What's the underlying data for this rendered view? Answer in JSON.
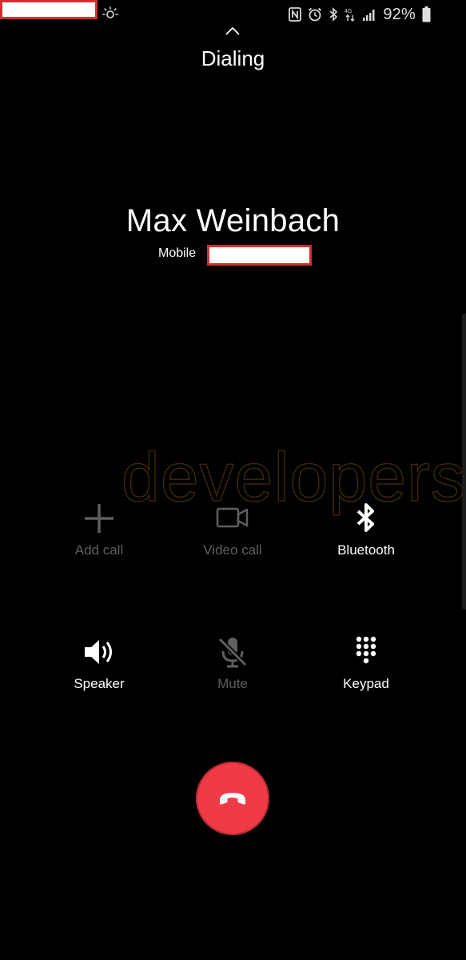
{
  "status_bar": {
    "battery_percent": "92%",
    "icons": [
      "nfc-icon",
      "alarm-icon",
      "bluetooth-icon",
      "data-icon",
      "signal-icon",
      "battery-icon"
    ]
  },
  "call": {
    "status": "Dialing",
    "contact_name": "Max Weinbach",
    "number_type": "Mobile"
  },
  "watermark": "developers",
  "controls": [
    {
      "label": "Add call",
      "icon": "add-call-icon",
      "enabled": false
    },
    {
      "label": "Video call",
      "icon": "video-call-icon",
      "enabled": false
    },
    {
      "label": "Bluetooth",
      "icon": "bluetooth-icon",
      "enabled": true
    },
    {
      "label": "Speaker",
      "icon": "speaker-icon",
      "enabled": true
    },
    {
      "label": "Mute",
      "icon": "mute-icon",
      "enabled": false
    },
    {
      "label": "Keypad",
      "icon": "keypad-icon",
      "enabled": true
    }
  ],
  "colors": {
    "background": "#000000",
    "end_call": "#ef3b46",
    "disabled": "#5f5f5f",
    "redaction_border": "#d32f2f"
  }
}
